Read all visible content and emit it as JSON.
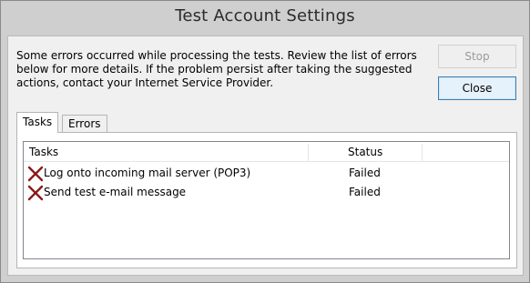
{
  "window": {
    "title": "Test Account Settings"
  },
  "message": "Some errors occurred while processing the tests. Review the list of errors below for more details. If the problem persist after taking the suggested actions, contact your Internet Service Provider.",
  "buttons": {
    "stop_label": "Stop",
    "close_label": "Close"
  },
  "tabs": [
    {
      "label": "Tasks",
      "active": true
    },
    {
      "label": "Errors",
      "active": false
    }
  ],
  "table": {
    "columns": [
      "Tasks",
      "Status"
    ],
    "rows": [
      {
        "icon": "red-x-icon",
        "task": "Log onto incoming mail server (POP3)",
        "status": "Failed"
      },
      {
        "icon": "red-x-icon",
        "task": "Send test e-mail message",
        "status": "Failed"
      }
    ]
  },
  "colors": {
    "failed_icon": "#8b1a1a",
    "close_button_border": "#3c7fb1"
  }
}
